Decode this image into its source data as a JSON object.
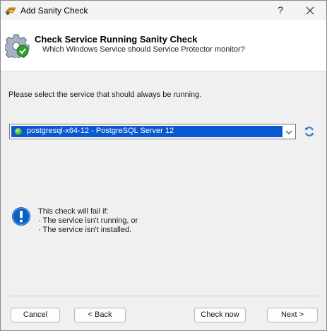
{
  "window": {
    "title": "Add Sanity Check",
    "help_label": "?",
    "icons": {
      "app": "app-icon",
      "close": "close-icon"
    }
  },
  "header": {
    "title": "Check Service Running Sanity Check",
    "subtitle": "Which Windows Service should Service Protector monitor?",
    "icon": "gear-check-icon"
  },
  "main": {
    "instruction": "Please select the service that should always be running.",
    "service_select": {
      "selected": "postgresql-x64-12 - PostgreSQL Server 12",
      "status_icon": "running-status-icon",
      "refresh_icon": "refresh-icon"
    },
    "info": {
      "icon": "info-icon",
      "heading": "This check will fail if:",
      "lines": [
        "· The service isn't running, or",
        "· The service isn't installed."
      ]
    }
  },
  "footer": {
    "cancel_label": "Cancel",
    "back_label": "< Back",
    "check_now_label": "Check now",
    "next_label": "Next >"
  },
  "colors": {
    "selection": "#0a58d0",
    "info_blue": "#0a5fc4",
    "running_green": "#3aa515"
  }
}
